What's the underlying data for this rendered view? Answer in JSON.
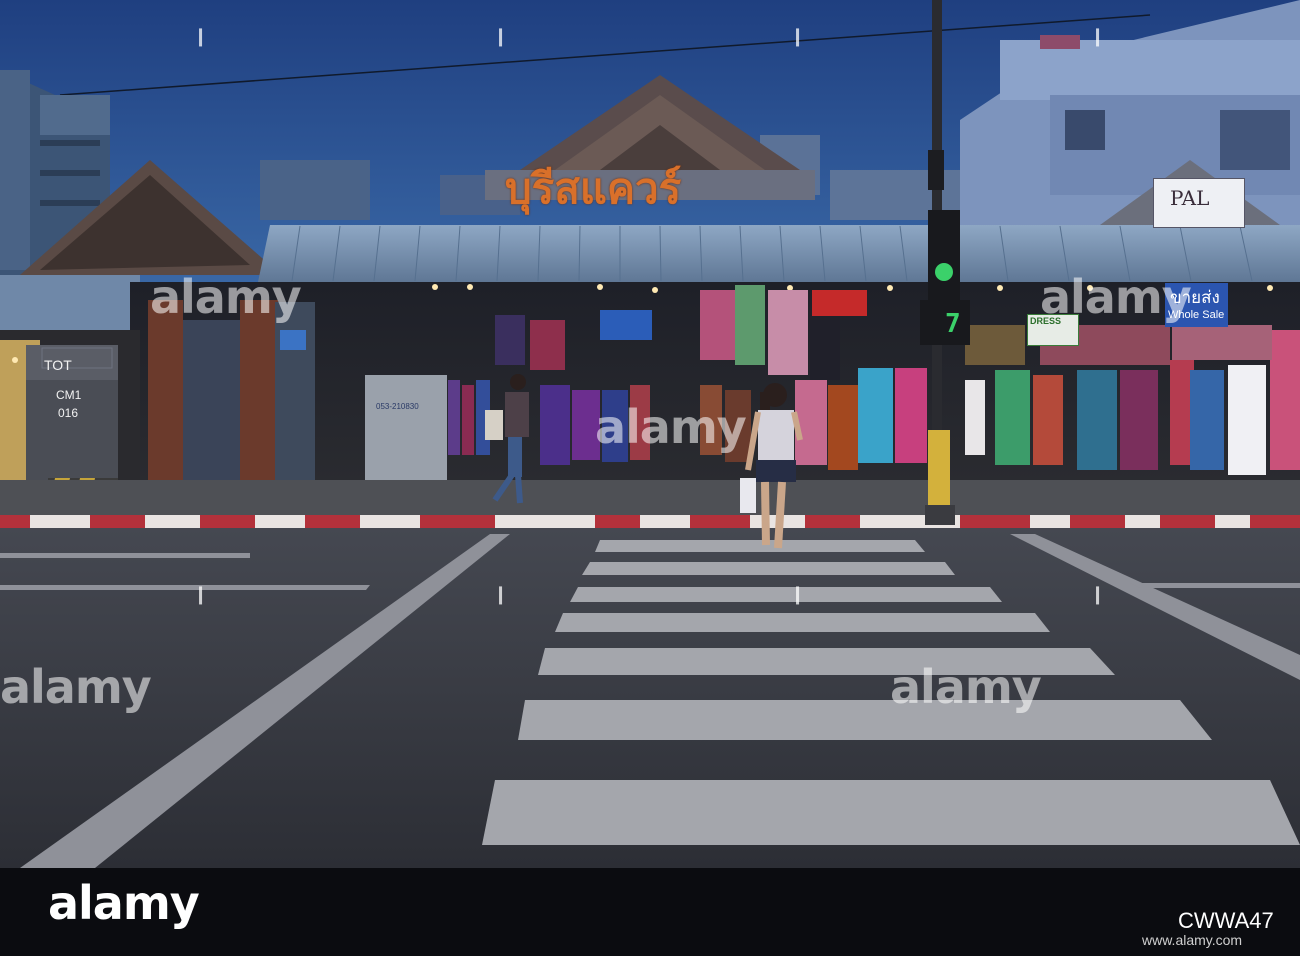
{
  "signs": {
    "main_thai": "บุรีสแควร์",
    "pal_title": "PAL",
    "tot_brand": "TOT",
    "tot_code": "CM1",
    "tot_num": "016",
    "box_phone": "053-210830",
    "wholesale_thai": "ขายส่ง",
    "wholesale_en": "Whole Sale",
    "dress_sign": "DRESS",
    "signal_count": "7"
  },
  "watermark": {
    "text": "alamy"
  },
  "footer": {
    "logo": "alamy",
    "image_id": "CWWA47",
    "url": "www.alamy.com"
  },
  "colors": {
    "sky": "#2a4f8f",
    "sign_orange": "#d9702a",
    "roof": "#7f9ab7",
    "road": "#3b3e46",
    "signal_green": "#3bd16a"
  }
}
